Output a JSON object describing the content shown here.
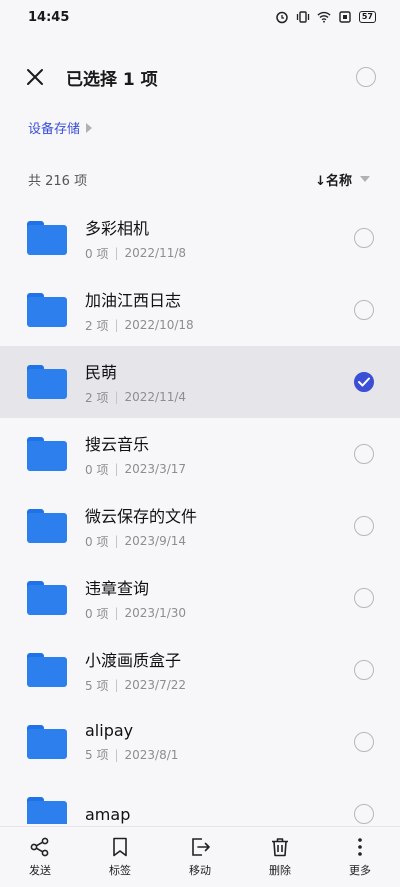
{
  "status_bar": {
    "time": "14:45",
    "battery": "57"
  },
  "header": {
    "title": "已选择 1 项"
  },
  "breadcrumb": {
    "label": "设备存储"
  },
  "list_meta": {
    "count": "共 216 项",
    "sort_label": "↓名称"
  },
  "files": [
    {
      "name": "多彩相机",
      "items": "0 项",
      "date": "2022/11/8",
      "selected": false
    },
    {
      "name": "加油江西日志",
      "items": "2 项",
      "date": "2022/10/18",
      "selected": false
    },
    {
      "name": "民萌",
      "items": "2 项",
      "date": "2022/11/4",
      "selected": true
    },
    {
      "name": "搜云音乐",
      "items": "0 项",
      "date": "2023/3/17",
      "selected": false
    },
    {
      "name": "微云保存的文件",
      "items": "0 项",
      "date": "2023/9/14",
      "selected": false
    },
    {
      "name": "违章查询",
      "items": "0 项",
      "date": "2023/1/30",
      "selected": false
    },
    {
      "name": "小渡画质盒子",
      "items": "5 项",
      "date": "2023/7/22",
      "selected": false
    },
    {
      "name": "alipay",
      "items": "5 项",
      "date": "2023/8/1",
      "selected": false
    },
    {
      "name": "amap",
      "items": "",
      "date": "",
      "selected": false
    }
  ],
  "actions": [
    {
      "label": "发送",
      "icon": "share-icon"
    },
    {
      "label": "标签",
      "icon": "bookmark-icon"
    },
    {
      "label": "移动",
      "icon": "move-icon"
    },
    {
      "label": "删除",
      "icon": "trash-icon"
    },
    {
      "label": "更多",
      "icon": "more-icon"
    }
  ],
  "colors": {
    "accent": "#3a4ed6",
    "folder": "#2e7fee"
  }
}
